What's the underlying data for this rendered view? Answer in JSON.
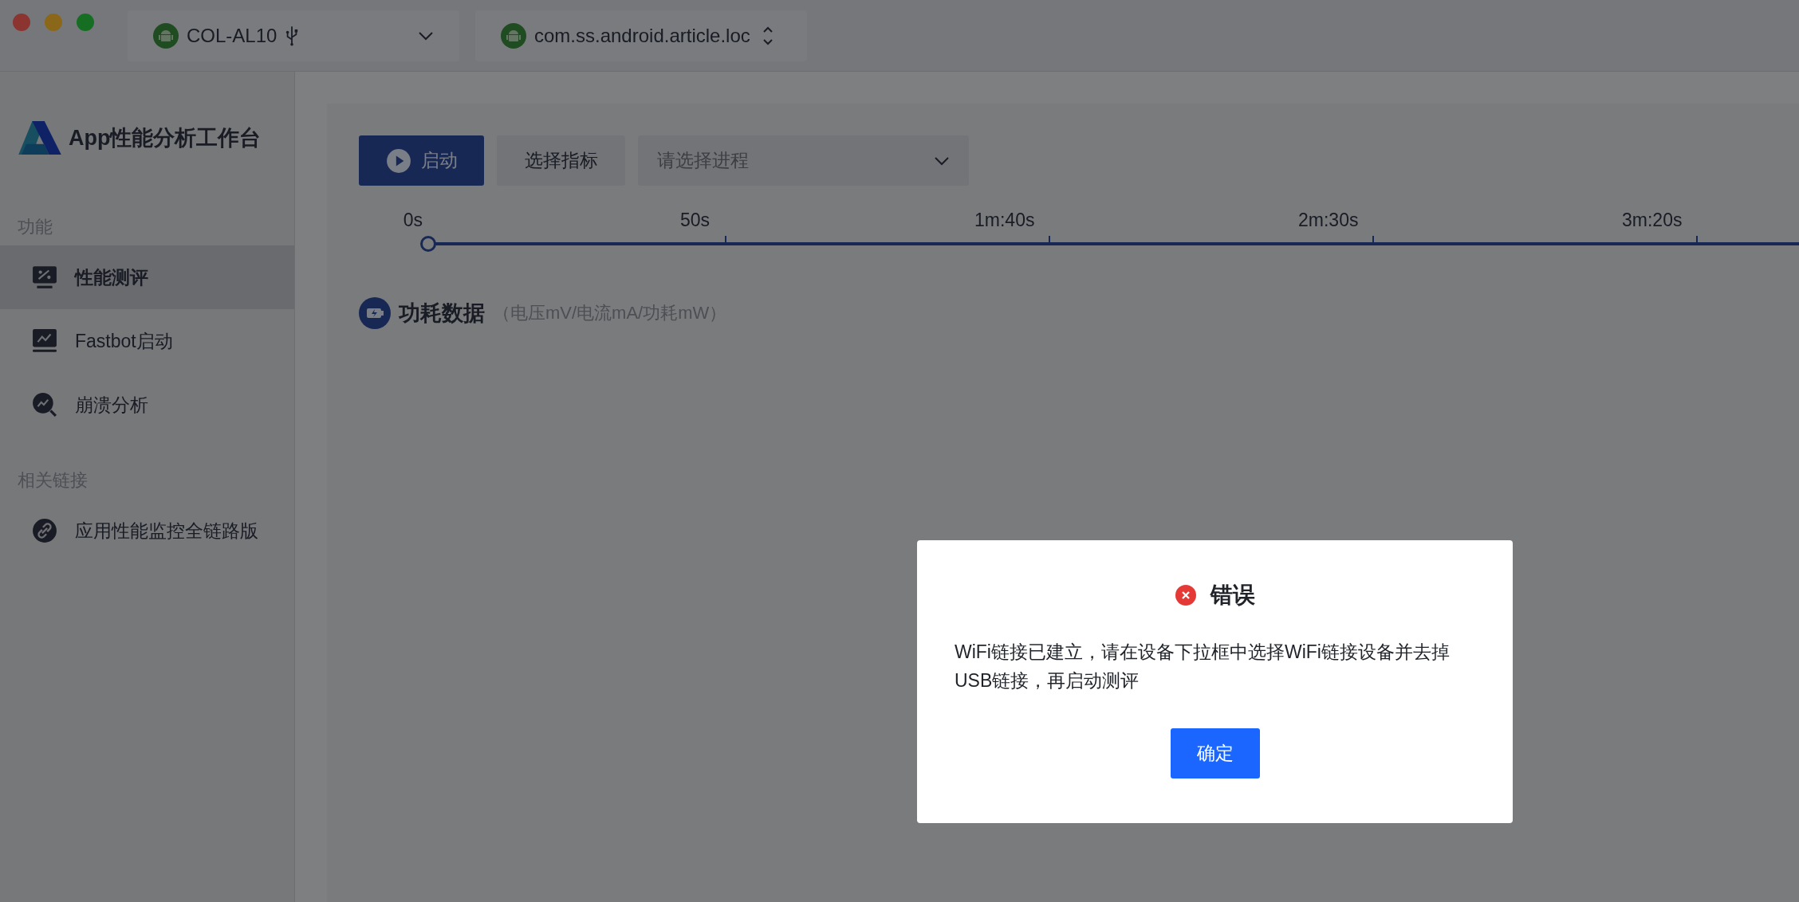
{
  "titlebar": {
    "device_select": {
      "value": "COL-AL10"
    },
    "app_select": {
      "value": "com.ss.android.article.loc"
    }
  },
  "sidebar": {
    "app_title": "App性能分析工作台",
    "sections": [
      {
        "heading": "功能",
        "items": [
          {
            "label": "性能测评",
            "kind": "monitor",
            "selected": true
          },
          {
            "label": "Fastbot启动",
            "kind": "chart",
            "selected": false
          },
          {
            "label": "崩溃分析",
            "kind": "magnifier",
            "selected": false
          }
        ]
      },
      {
        "heading": "相关链接",
        "items": [
          {
            "label": "应用性能监控全链路版",
            "kind": "link",
            "selected": false
          }
        ]
      }
    ]
  },
  "toolbar": {
    "start_button": "启动",
    "metrics_button": "选择指标",
    "process_select": {
      "placeholder": "请选择进程"
    }
  },
  "timeline": {
    "level": 0,
    "ticks": [
      "0s",
      "50s",
      "1m:40s",
      "2m:30s",
      "3m:20s"
    ]
  },
  "section": {
    "title": "功耗数据",
    "subtitle": "（电压mV/电流mA/功耗mW）"
  },
  "dialog": {
    "title": "错误",
    "message": "WiFi链接已建立，请在设备下拉框中选择WiFi链接设备并去掉USB链接，再启动测评",
    "button": "确定"
  }
}
